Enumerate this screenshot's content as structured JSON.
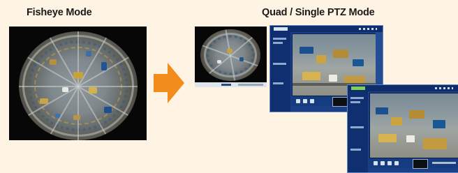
{
  "labels": {
    "fisheye_mode": "Fisheye Mode",
    "quad_single_ptz_mode": "Quad / Single PTZ Mode"
  },
  "colors": {
    "background": "#fff4e3",
    "arrow": "#f28c1a",
    "ui_panel": "#1a3f86",
    "ui_header": "#0e2d6a"
  },
  "icons": {
    "arrow": "arrow-right-icon"
  }
}
